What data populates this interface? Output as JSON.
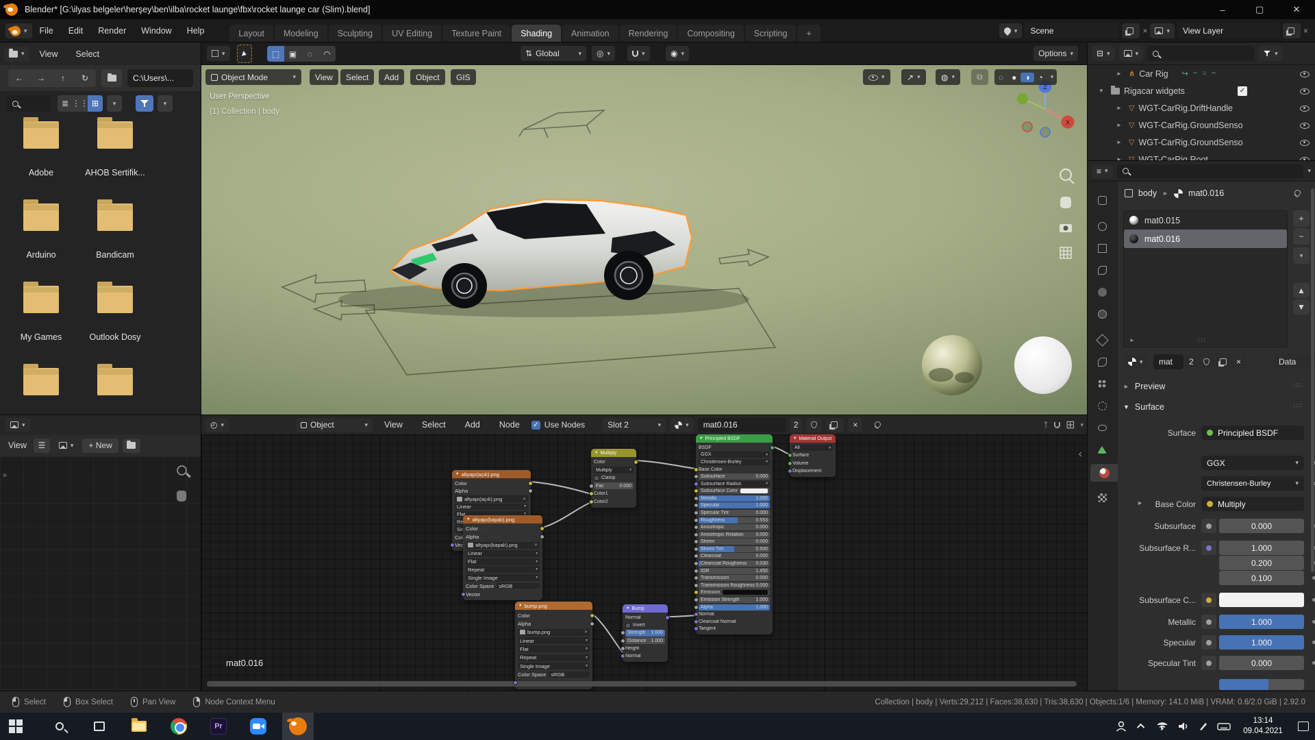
{
  "window": {
    "title": "Blender* [G:\\ilyas belgeler\\herşey\\ben\\ilba\\rocket launge\\fbx\\rocket launge car (Slim).blend]",
    "minimize": "–",
    "maximize": "▢",
    "close": "✕"
  },
  "topbar": {
    "menus": [
      {
        "label": "File"
      },
      {
        "label": "Edit"
      },
      {
        "label": "Render"
      },
      {
        "label": "Window"
      },
      {
        "label": "Help"
      }
    ],
    "tabs": [
      {
        "label": "Layout"
      },
      {
        "label": "Modeling"
      },
      {
        "label": "Sculpting"
      },
      {
        "label": "UV Editing"
      },
      {
        "label": "Texture Paint"
      },
      {
        "label": "Shading",
        "state": "active"
      },
      {
        "label": "Animation"
      },
      {
        "label": "Rendering"
      },
      {
        "label": "Compositing"
      },
      {
        "label": "Scripting"
      },
      {
        "label": "+"
      }
    ],
    "scene_name": "Scene",
    "view_layer_name": "View Layer"
  },
  "tool_settings": {
    "orientation": "Global",
    "options_label": "Options"
  },
  "file_browser": {
    "menus": [
      {
        "label": "View"
      },
      {
        "label": "Select"
      }
    ],
    "path": "C:\\Users\\...",
    "folders": [
      {
        "name": "Adobe"
      },
      {
        "name": "AHOB Sertifik..."
      },
      {
        "name": "Arduino"
      },
      {
        "name": "Bandicam"
      },
      {
        "name": "My Games"
      },
      {
        "name": "Outlook Dosy"
      },
      {
        "name": ""
      },
      {
        "name": ""
      }
    ]
  },
  "image_editor": {
    "view_label": "View",
    "new_label": "+ New"
  },
  "viewport": {
    "mode": "Object Mode",
    "menus": [
      {
        "label": "View"
      },
      {
        "label": "Select"
      },
      {
        "label": "Add"
      },
      {
        "label": "Object"
      },
      {
        "label": "GIS"
      }
    ],
    "overlay_line1": "User Perspective",
    "overlay_line2": "(1) Collection | body",
    "axis_x": "X",
    "axis_z": "Z"
  },
  "outliner": {
    "rows": [
      {
        "exp": "►",
        "ico": "ico-armature",
        "glyph": "⋔",
        "name": "Car Rig",
        "lvl": "lvl1",
        "extras": true
      },
      {
        "exp": "▼",
        "ico": "ico-collection",
        "glyph": "",
        "name": "Rigacar widgets",
        "lvl": "lvl0",
        "check": "✓"
      },
      {
        "exp": "►",
        "ico": "ico-widget",
        "glyph": "▽",
        "name": "WGT-CarRig.DriftHandle",
        "lvl": "lvl1"
      },
      {
        "exp": "►",
        "ico": "ico-widget",
        "glyph": "▽",
        "name": "WGT-CarRig.GroundSenso",
        "lvl": "lvl1"
      },
      {
        "exp": "►",
        "ico": "ico-widget",
        "glyph": "▽",
        "name": "WGT-CarRig.GroundSenso",
        "lvl": "lvl1"
      },
      {
        "exp": "►",
        "ico": "ico-widget",
        "glyph": "▽",
        "name": "WGT-CarRig.Root",
        "lvl": "lvl1",
        "wire": "▽"
      }
    ]
  },
  "properties": {
    "breadcrumb": {
      "object": "body",
      "material": "mat0.016"
    },
    "slots": [
      {
        "name": "mat0.015"
      },
      {
        "name": "mat0.016"
      }
    ],
    "datablock": {
      "name": "mat",
      "users": "2",
      "link": "Data"
    },
    "panel_preview": "Preview",
    "panel_surface": "Surface",
    "rows": {
      "surface": {
        "label": "Surface",
        "value": "Principled BSDF"
      },
      "ggx": "GGX",
      "cb": "Christensen-Burley",
      "base_color": {
        "label": "Base Color",
        "value": "Multiply"
      },
      "subsurface": {
        "label": "Subsurface",
        "value": "0.000"
      },
      "subsurface_r": {
        "label": "Subsurface R...",
        "v1": "1.000",
        "v2": "0.200",
        "v3": "0.100"
      },
      "subsurface_c": {
        "label": "Subsurface C..."
      },
      "metallic": {
        "label": "Metallic",
        "value": "1.000"
      },
      "specular": {
        "label": "Specular",
        "value": "1.000"
      },
      "specular_tint": {
        "label": "Specular Tint",
        "value": "0.000"
      }
    }
  },
  "shader_editor": {
    "object_selector": "Object",
    "menus": [
      {
        "label": "View"
      },
      {
        "label": "Select"
      },
      {
        "label": "Add"
      },
      {
        "label": "Node"
      }
    ],
    "use_nodes_label": "Use Nodes",
    "slot_label": "Slot 2",
    "material_name": "mat0.016",
    "material_users": "2",
    "overlay_label": "mat0.016",
    "nodes": {
      "tex_open": {
        "title": "altyapı(açık).png",
        "rows": [
          {
            "t": "out",
            "label": "Color",
            "sock": "#c8b73c"
          },
          {
            "t": "out",
            "label": "Alpha",
            "sock": "#a0a0a0"
          },
          {
            "t": "img",
            "label": "altyapı(açık).png"
          },
          {
            "t": "drop",
            "label": "Linear"
          },
          {
            "t": "drop",
            "label": "Flat"
          },
          {
            "t": "drop",
            "label": "Repeat"
          },
          {
            "t": "drop",
            "label": "Single Image"
          },
          {
            "t": "cs",
            "label": "Color Space",
            "value": "sRGB"
          },
          {
            "t": "in",
            "label": "Vector",
            "sock": "#7a76c9"
          }
        ]
      },
      "tex_closed": {
        "title": "altyapı(kapalı).png",
        "rows": [
          {
            "t": "out",
            "label": "Color",
            "sock": "#c8b73c"
          },
          {
            "t": "out",
            "label": "Alpha",
            "sock": "#a0a0a0"
          },
          {
            "t": "img",
            "label": "altyapı(kapalı).png"
          },
          {
            "t": "drop",
            "label": "Linear"
          },
          {
            "t": "drop",
            "label": "Flat"
          },
          {
            "t": "drop",
            "label": "Repeat"
          },
          {
            "t": "drop",
            "label": "Single Image"
          },
          {
            "t": "cs",
            "label": "Color Space",
            "value": "sRGB"
          },
          {
            "t": "in",
            "label": "Vector",
            "sock": "#7a76c9"
          }
        ]
      },
      "mix": {
        "title": "Multiply",
        "rows": [
          {
            "t": "out",
            "label": "Color",
            "sock": "#c8b73c"
          },
          {
            "t": "drop",
            "label": "Multiply"
          },
          {
            "t": "check",
            "label": "Clamp"
          },
          {
            "t": "slider",
            "label": "Fac",
            "value": "0.000",
            "fill": "0%",
            "sock": "#a0a0a0"
          },
          {
            "t": "in",
            "label": "Color1",
            "sock": "#c8b73c"
          },
          {
            "t": "in",
            "label": "Color2",
            "sock": "#c8b73c"
          }
        ]
      },
      "tex_bump": {
        "title": "bump.png",
        "rows": [
          {
            "t": "out",
            "label": "Color",
            "sock": "#c8b73c"
          },
          {
            "t": "out",
            "label": "Alpha",
            "sock": "#a0a0a0"
          },
          {
            "t": "img",
            "label": "bump.png"
          },
          {
            "t": "drop",
            "label": "Linear"
          },
          {
            "t": "drop",
            "label": "Flat"
          },
          {
            "t": "drop",
            "label": "Repeat"
          },
          {
            "t": "drop",
            "label": "Single Image"
          },
          {
            "t": "cs",
            "label": "Color Space",
            "value": "sRGB"
          },
          {
            "t": "in",
            "label": "Vector",
            "sock": "#7a76c9"
          }
        ]
      },
      "bump": {
        "title": "Bump",
        "rows": [
          {
            "t": "out",
            "label": "Normal",
            "sock": "#7a76c9"
          },
          {
            "t": "check",
            "label": "Invert"
          },
          {
            "t": "slider",
            "label": "Strength",
            "value": "1.000",
            "fill": "100%",
            "sock": "#a0a0a0"
          },
          {
            "t": "slider",
            "label": "Distance",
            "value": "1.000",
            "fill": "0%",
            "sock": "#a0a0a0"
          },
          {
            "t": "in",
            "label": "Height",
            "sock": "#a0a0a0"
          },
          {
            "t": "in",
            "label": "Normal",
            "sock": "#7a76c9"
          }
        ]
      },
      "principled": {
        "title": "Principled BSDF",
        "rows": [
          {
            "t": "out",
            "label": "BSDF",
            "sock": "#52b152"
          },
          {
            "t": "drop",
            "label": "GGX"
          },
          {
            "t": "drop",
            "label": "Christensen-Burley"
          },
          {
            "t": "in",
            "label": "Base Color",
            "sock": "#c8b73c"
          },
          {
            "t": "slider",
            "label": "Subsurface",
            "value": "0.000",
            "fill": "0%",
            "sock": "#a0a0a0"
          },
          {
            "t": "drop",
            "label": "Subsurface Radius",
            "sock": "#7a76c9"
          },
          {
            "t": "color",
            "label": "Subsurface Color",
            "color": "#f0f0f0",
            "sock": "#c8b73c"
          },
          {
            "t": "slider",
            "label": "Metallic",
            "value": "1.000",
            "fill": "100%",
            "sock": "#a0a0a0"
          },
          {
            "t": "slider",
            "label": "Specular",
            "value": "1.000",
            "fill": "100%",
            "sock": "#a0a0a0"
          },
          {
            "t": "slider",
            "label": "Specular Tint",
            "value": "0.000",
            "fill": "0%",
            "sock": "#a0a0a0"
          },
          {
            "t": "slider",
            "label": "Roughness",
            "value": "0.553",
            "fill": "55%",
            "sock": "#a0a0a0"
          },
          {
            "t": "slider",
            "label": "Anisotropic",
            "value": "0.000",
            "fill": "0%",
            "sock": "#a0a0a0"
          },
          {
            "t": "slider",
            "label": "Anisotropic Rotation",
            "value": "0.000",
            "fill": "0%",
            "sock": "#a0a0a0"
          },
          {
            "t": "slider",
            "label": "Sheen",
            "value": "0.000",
            "fill": "0%",
            "sock": "#a0a0a0"
          },
          {
            "t": "slider",
            "label": "Sheen Tint",
            "value": "0.500",
            "fill": "50%",
            "sock": "#a0a0a0"
          },
          {
            "t": "slider",
            "label": "Clearcoat",
            "value": "0.000",
            "fill": "0%",
            "sock": "#a0a0a0"
          },
          {
            "t": "slider",
            "label": "Clearcoat Roughness",
            "value": "0.030",
            "fill": "3%",
            "sock": "#a0a0a0"
          },
          {
            "t": "slider",
            "label": "IOR",
            "value": "1.450",
            "fill": "0%",
            "sock": "#a0a0a0"
          },
          {
            "t": "slider",
            "label": "Transmission",
            "value": "0.000",
            "fill": "0%",
            "sock": "#a0a0a0"
          },
          {
            "t": "slider",
            "label": "Transmission Roughness",
            "value": "0.000",
            "fill": "0%",
            "sock": "#a0a0a0"
          },
          {
            "t": "color",
            "label": "Emission",
            "color": "#0c0c0c",
            "sock": "#c8b73c"
          },
          {
            "t": "slider",
            "label": "Emission Strength",
            "value": "1.000",
            "fill": "0%",
            "sock": "#a0a0a0"
          },
          {
            "t": "slider",
            "label": "Alpha",
            "value": "1.000",
            "fill": "100%",
            "sock": "#a0a0a0"
          },
          {
            "t": "in",
            "label": "Normal",
            "sock": "#7a76c9"
          },
          {
            "t": "in",
            "label": "Clearcoat Normal",
            "sock": "#7a76c9"
          },
          {
            "t": "in",
            "label": "Tangent",
            "sock": "#7a76c9"
          }
        ]
      },
      "output": {
        "title": "Material Output",
        "rows": [
          {
            "t": "drop",
            "label": "All"
          },
          {
            "t": "in",
            "label": "Surface",
            "sock": "#52b152"
          },
          {
            "t": "in",
            "label": "Volume",
            "sock": "#52b152"
          },
          {
            "t": "in",
            "label": "Displacement",
            "sock": "#7a76c9"
          }
        ]
      }
    }
  },
  "status_bar": {
    "hints": [
      {
        "label": "Select",
        "cls": "m-l"
      },
      {
        "label": "Box Select",
        "cls": "m-l"
      },
      {
        "label": "Pan View",
        "cls": "m-m"
      },
      {
        "label": "Node Context Menu",
        "cls": "m-r"
      }
    ],
    "stats": "Collection | body | Verts:29,212 | Faces:38,630 | Tris:38,630 | Objects:1/6 | Memory: 141.0 MiB | VRAM: 0.6/2.0 GiB | 2.92.0"
  },
  "taskbar": {
    "premiere_label": "Pr",
    "clock_time": "13:14",
    "clock_date": "09.04.2021"
  }
}
